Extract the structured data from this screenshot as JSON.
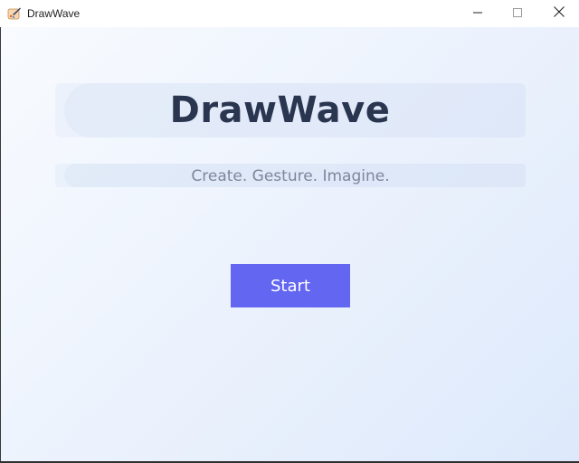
{
  "window": {
    "title": "DrawWave",
    "icon": "paint-brush-icon",
    "controls": {
      "minimize": "minimize-icon",
      "maximize": "maximize-icon",
      "close": "close-icon"
    }
  },
  "main": {
    "heading": "DrawWave",
    "tagline": "Create. Gesture. Imagine.",
    "start_label": "Start"
  },
  "colors": {
    "accent": "#6366f1",
    "heading": "#2a3550",
    "tagline": "#7d879c",
    "background_start": "#f8fbff",
    "background_end": "#dde9fb"
  }
}
